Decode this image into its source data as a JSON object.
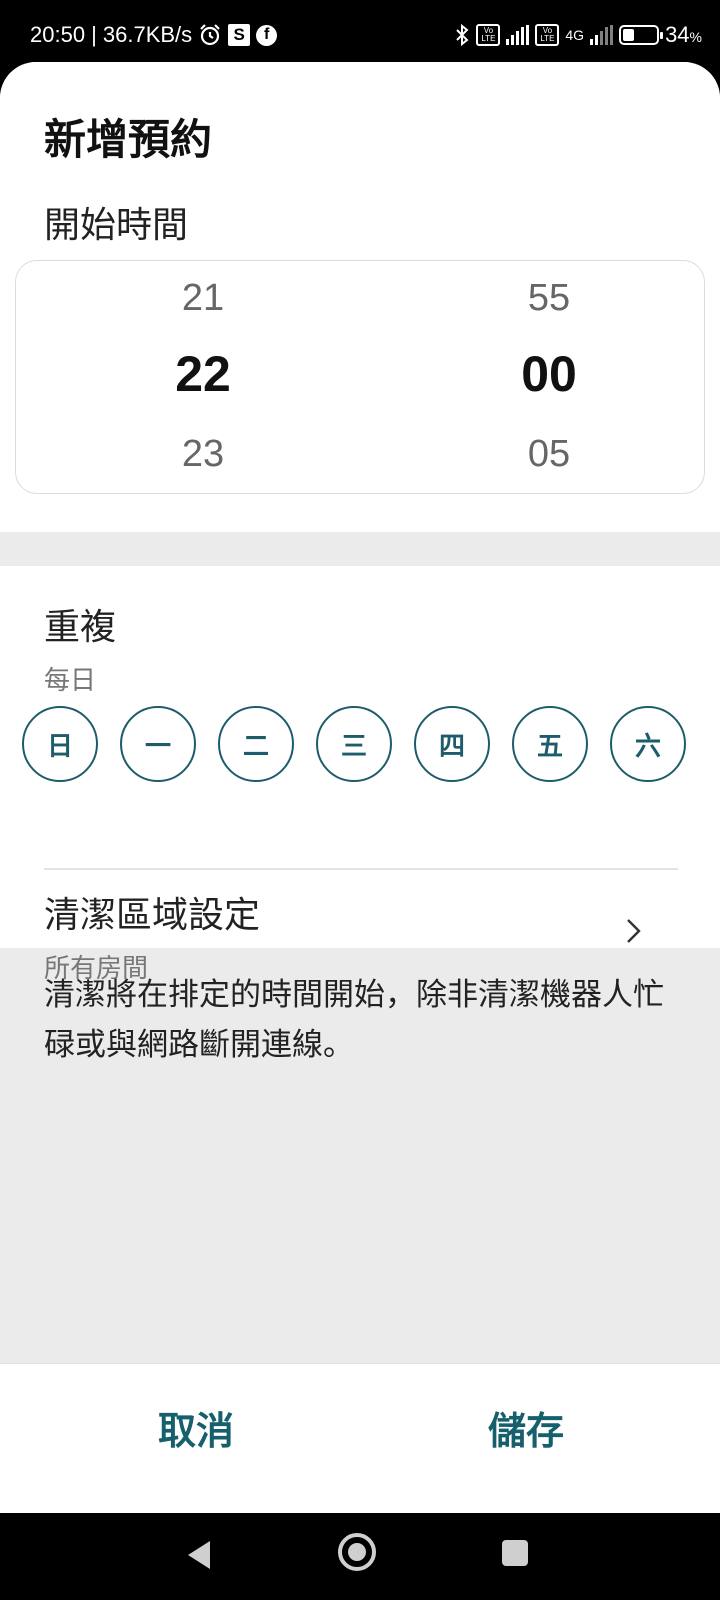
{
  "status_bar": {
    "time": "20:50",
    "net_speed": "| 36.7KB/s",
    "alarm_icon": "alarm-icon",
    "s_icon_letter": "S",
    "facebook_letter": "f",
    "bluetooth_icon": "bluetooth-icon",
    "volte1": "Vo LTE",
    "volte2": "Vo LTE",
    "net_type": "4G",
    "battery_percent": 34,
    "battery_text": "34",
    "battery_sign": "%"
  },
  "sheet": {
    "title": "新增預約",
    "start_label": "開始時間",
    "picker": {
      "hours": {
        "prev": "21",
        "selected": "22",
        "next": "23"
      },
      "minutes": {
        "prev": "55",
        "selected": "00",
        "next": "05"
      }
    },
    "repeat": {
      "title": "重複",
      "subtitle": "每日",
      "days": [
        "日",
        "一",
        "二",
        "三",
        "四",
        "五",
        "六"
      ]
    },
    "area": {
      "title": "清潔區域設定",
      "subtitle": "所有房間"
    },
    "note": "清潔將在排定的時間開始，除非清潔機器人忙碌或與網路斷開連線。"
  },
  "buttons": {
    "cancel": "取消",
    "save": "儲存"
  },
  "colors": {
    "accent": "#16606e",
    "day_border": "#1e5c6b",
    "sheet_gray": "#ebebeb"
  }
}
